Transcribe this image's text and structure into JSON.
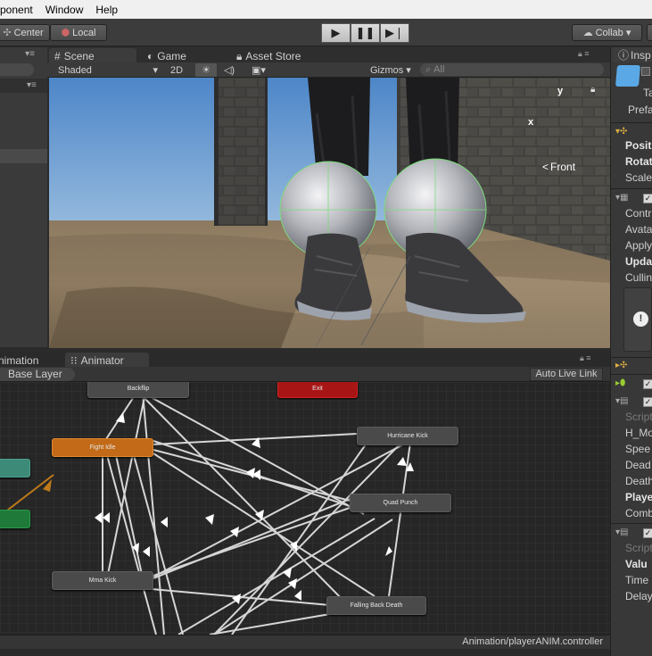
{
  "menu": {
    "items": [
      "ponent",
      "Window",
      "Help"
    ]
  },
  "toolbar": {
    "pivot_label": "Center",
    "space_label": "Local",
    "collab_label": "Collab ▾"
  },
  "scene_tabs": {
    "scene": "Scene",
    "game": "Game",
    "asset_store": "Asset Store",
    "inspector": "Insp"
  },
  "scene_toolbar": {
    "shading": "Shaded",
    "mode_2d": "2D",
    "gizmos": "Gizmos",
    "search_placeholder": "All"
  },
  "scene_gizmo": {
    "y": "y",
    "x": "x",
    "front": "Front"
  },
  "animator_tabs": {
    "animation": "Animation",
    "animator": "Animator"
  },
  "animator": {
    "layer": "Base Layer",
    "auto_live_link": "Auto Live Link",
    "status_path": "Animation/playerANIM.controller",
    "states": {
      "backflip": "Backflip",
      "exit": "Exit",
      "fight_idle": "Fight Idle",
      "hurricane_kick": "Hurricane Kick",
      "quad_punch": "Quad Punch",
      "mma_kick": "Mma Kick",
      "falling_back_death": "Falling Back Death"
    }
  },
  "inspector": {
    "header": {
      "tag": "Ta",
      "prefab": "Prefa"
    },
    "transform": [
      "Posit",
      "Rotat",
      "Scale"
    ],
    "animator_fields": [
      "Contr",
      "Avata",
      "Apply",
      "Upda",
      "Cullin"
    ],
    "script1_fields": {
      "script": "Script",
      "f1": "H_Mo",
      "f2": "Spee",
      "f3": "Dead",
      "f4": "Death",
      "f5": "Playe",
      "f6": "Comb"
    },
    "script2_fields": {
      "script": "Script",
      "f1": "Valu",
      "f2": "Time",
      "f3": "Delay"
    }
  },
  "colors": {
    "state_default": "#4a4a4a",
    "state_default_entry": "#c26a17",
    "state_exit": "#a81515",
    "state_any": "#3d8a78",
    "state_entry": "#1f7a3a"
  }
}
